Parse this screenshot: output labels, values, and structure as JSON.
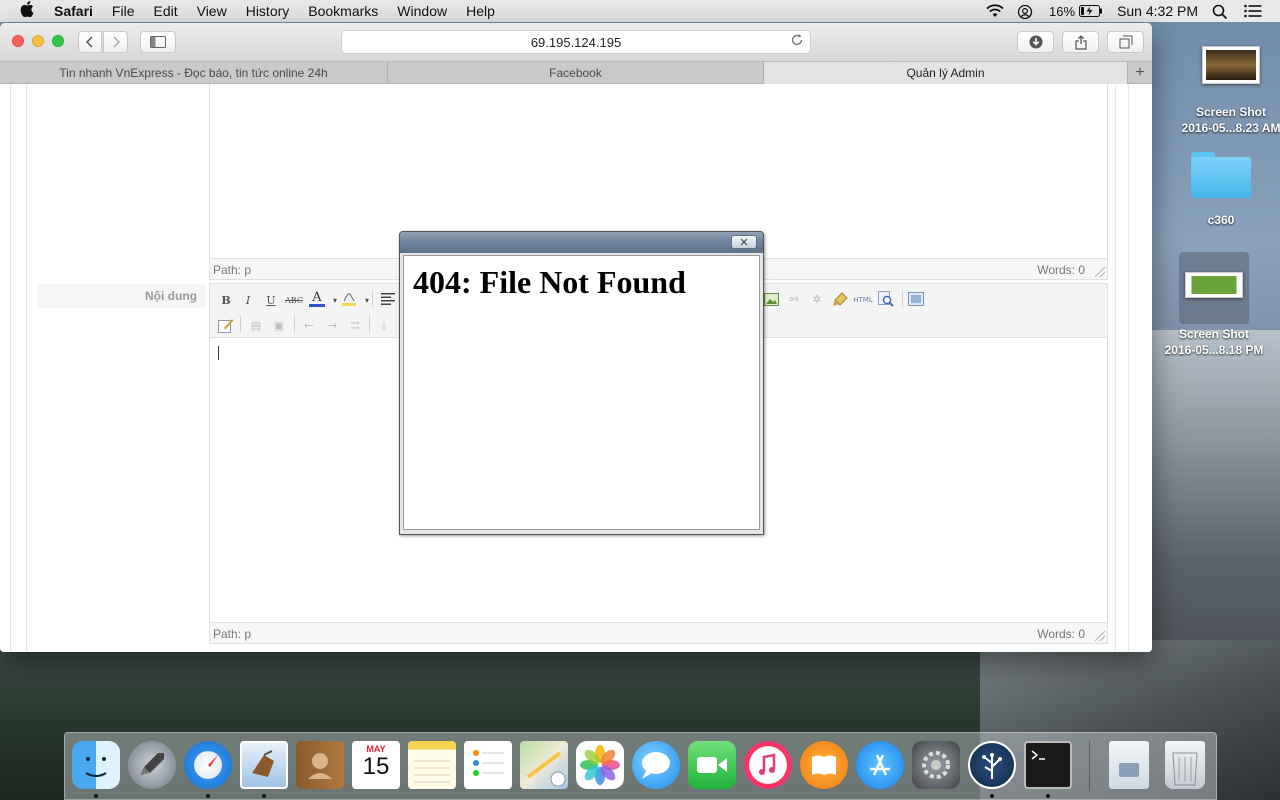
{
  "menubar": {
    "app_name": "Safari",
    "items": [
      "File",
      "Edit",
      "View",
      "History",
      "Bookmarks",
      "Window",
      "Help"
    ],
    "battery_percent": "16%",
    "clock": "Sun 4:32 PM"
  },
  "browser": {
    "url": "69.195.124.195",
    "tabs": [
      {
        "label": "Tin nhanh VnExpress - Đọc báo, tin tức online 24h"
      },
      {
        "label": "Facebook"
      },
      {
        "label": "Quản lý Admin"
      }
    ],
    "new_tab_symbol": "+"
  },
  "editor": {
    "top_status": {
      "path": "Path: p",
      "words": "Words: 0"
    },
    "content_label": "Nội dung",
    "bottom_status": {
      "path": "Path: p",
      "words": "Words: 0"
    },
    "toolbar_text": {
      "bold": "B",
      "italic": "I",
      "underline": "U",
      "strike": "ABC",
      "font_color": "A",
      "html": "HTML"
    }
  },
  "popup": {
    "message": "404: File Not Found",
    "close_symbol": "✕"
  },
  "desktop": {
    "items": [
      {
        "label_line1": "Screen Shot",
        "label_line2": "2016-05...8.23 AM",
        "icon": "screenshot-icon"
      },
      {
        "label_line1": "c360",
        "label_line2": "",
        "icon": "folder-icon"
      },
      {
        "label_line1": "Screen Shot",
        "label_line2": "2016-05...8.18 PM",
        "icon": "screenshot-icon"
      }
    ]
  },
  "dock": {
    "calendar_month": "MAY",
    "calendar_day": "15",
    "apps": [
      "finder",
      "launchpad",
      "safari",
      "mail",
      "contacts",
      "calendar",
      "notes",
      "reminders",
      "maps",
      "photos",
      "messages",
      "facetime",
      "itunes",
      "ibooks",
      "app-store",
      "system-preferences",
      "sourcetree",
      "terminal",
      "downloads",
      "trash"
    ]
  },
  "colors": {
    "accent_blue": "#2f87e3",
    "popup_title": "#6d8299"
  }
}
